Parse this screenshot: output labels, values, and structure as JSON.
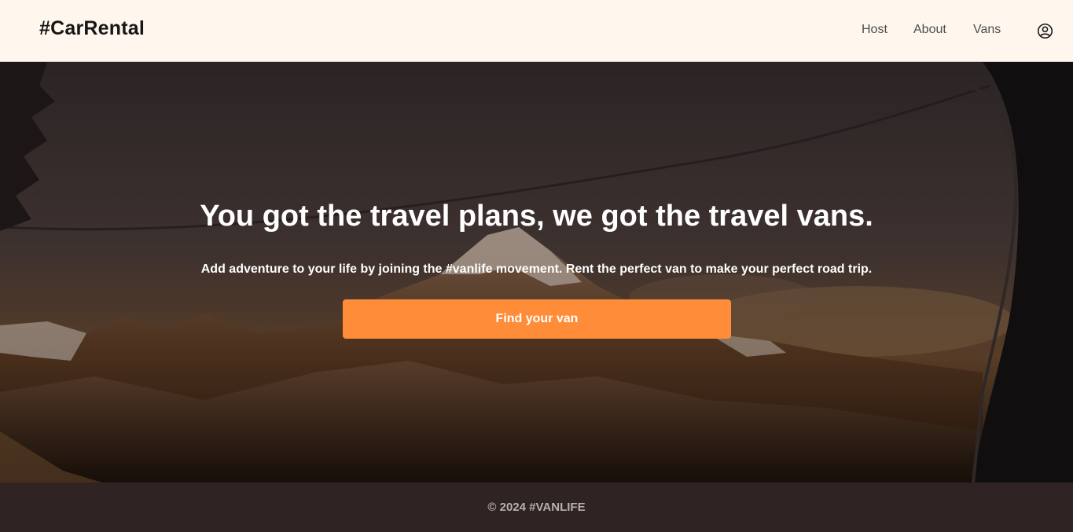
{
  "header": {
    "logo": "#CarRental",
    "nav": {
      "host": "Host",
      "about": "About",
      "vans": "Vans"
    },
    "user_icon": "user-circle-icon"
  },
  "hero": {
    "title": "You got the travel plans, we got the travel vans.",
    "subtitle": "Add adventure to your life by joining the #vanlife movement. Rent the perfect van to make your perfect road trip.",
    "cta_label": "Find your van",
    "cta_color": "#ff8c38"
  },
  "footer": {
    "text": "© 2024 #VANLIFE",
    "background": "#2f2324"
  },
  "colors": {
    "header_bg": "#fff7ed",
    "accent": "#ff8c38"
  }
}
